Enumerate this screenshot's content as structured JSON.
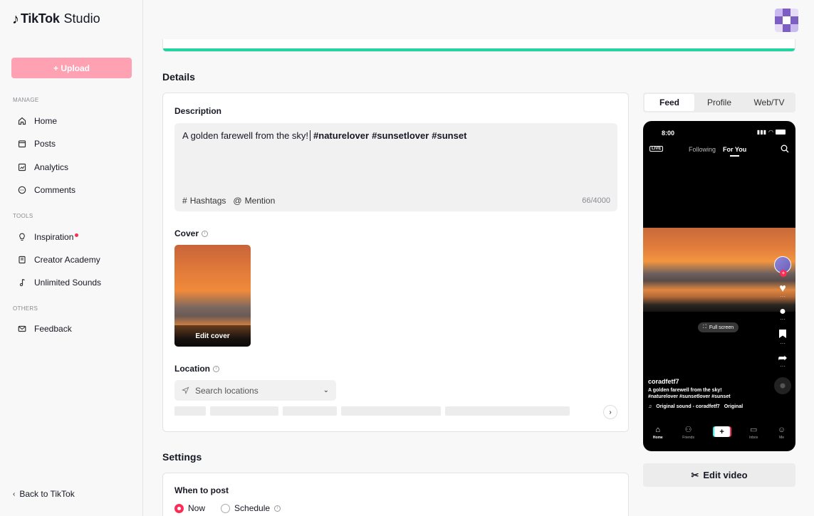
{
  "app": {
    "logo_note": "♪",
    "brand": "TikTok",
    "product": "Studio"
  },
  "sidebar": {
    "upload_label": "+ Upload",
    "sections": {
      "manage": "MANAGE",
      "tools": "TOOLS",
      "others": "OTHERS"
    },
    "items": [
      {
        "label": "Home",
        "icon": "home-icon"
      },
      {
        "label": "Posts",
        "icon": "posts-icon"
      },
      {
        "label": "Analytics",
        "icon": "analytics-icon"
      },
      {
        "label": "Comments",
        "icon": "comments-icon"
      },
      {
        "label": "Inspiration",
        "icon": "lightbulb-icon"
      },
      {
        "label": "Creator Academy",
        "icon": "academy-icon"
      },
      {
        "label": "Unlimited Sounds",
        "icon": "music-icon"
      },
      {
        "label": "Feedback",
        "icon": "mail-icon"
      }
    ],
    "back_label": "Back to TikTok"
  },
  "colors": {
    "accent": "#fe2c55",
    "upload_disabled": "#fea1b2",
    "progress": "#20d5a0"
  },
  "upload_progress": 1.0,
  "details": {
    "heading": "Details",
    "description": {
      "label": "Description",
      "text": "A golden farewell from the sky!",
      "tags": [
        "#naturelover",
        "#sunsetlover",
        "#sunset"
      ],
      "hashtags_label": "Hashtags",
      "mention_label": "Mention",
      "count": "66/4000"
    },
    "cover": {
      "label": "Cover",
      "edit_label": "Edit cover"
    },
    "location": {
      "label": "Location",
      "placeholder": "Search locations"
    }
  },
  "settings": {
    "heading": "Settings",
    "when_to_post": {
      "label": "When to post",
      "options": [
        "Now",
        "Schedule"
      ],
      "selected": "Now"
    }
  },
  "preview": {
    "tabs": [
      "Feed",
      "Profile",
      "Web/TV"
    ],
    "active_tab": "Feed",
    "phone": {
      "time": "8:00",
      "live": "LIVE",
      "tab_following": "Following",
      "tab_foryou": "For You",
      "fullscreen": "Full screen",
      "username": "coradfetf7",
      "caption_line1": "A golden farewell from the sky!",
      "caption_line2": "#naturelover #sunsetlover #sunset",
      "sound": "Original sound - coradfetf7",
      "sound_tail": "Original",
      "nav": [
        "Home",
        "Friends",
        "Inbox",
        "Me"
      ]
    },
    "edit_video_label": "Edit video"
  }
}
